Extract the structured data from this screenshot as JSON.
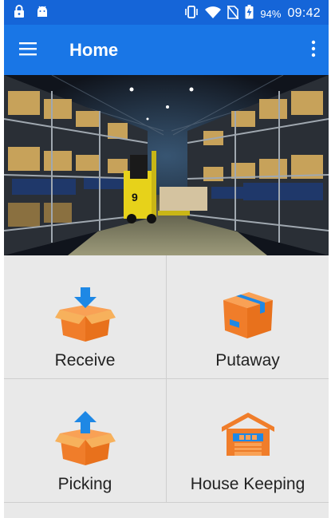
{
  "status_bar": {
    "battery_percent": "94%",
    "time": "09:42",
    "icons": [
      "lock-icon",
      "android-icon",
      "vibrate-icon",
      "wifi-icon",
      "no-sim-icon",
      "battery-charging-icon"
    ]
  },
  "app_bar": {
    "title": "Home",
    "menu_icon": "hamburger-menu-icon",
    "overflow_icon": "more-vertical-icon"
  },
  "tiles": [
    {
      "label": "Receive",
      "icon": "box-arrow-down-icon"
    },
    {
      "label": "Putaway",
      "icon": "closed-box-icon"
    },
    {
      "label": "Picking",
      "icon": "box-arrow-up-icon"
    },
    {
      "label": "House Keeping",
      "icon": "warehouse-icon"
    }
  ],
  "colors": {
    "primary": "#1976e6",
    "status_bar": "#1565d8",
    "box_orange": "#f07d2a",
    "arrow_blue": "#1e88e5"
  }
}
